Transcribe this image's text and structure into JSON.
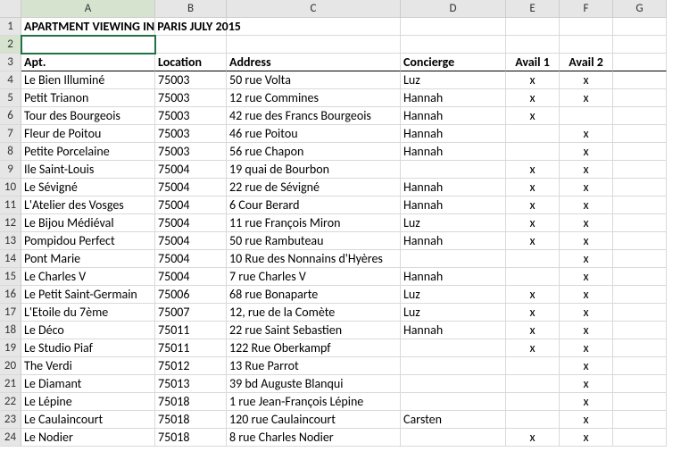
{
  "columns": [
    "A",
    "B",
    "C",
    "D",
    "E",
    "F",
    "G"
  ],
  "title": "APARTMENT VIEWING IN PARIS JULY 2015",
  "headers": {
    "apt": "Apt.",
    "location": "Location",
    "address": "Address",
    "concierge": "Concierge",
    "avail1": "Avail 1",
    "avail2": "Avail 2"
  },
  "active": {
    "col": 0,
    "row": 2
  },
  "rows": [
    {
      "n": 4,
      "apt": " Le Bien Illuminé",
      "loc": "75003",
      "addr": "50 rue Volta",
      "con": "Luz",
      "a1": "x",
      "a2": "x"
    },
    {
      "n": 5,
      "apt": " Petit Trianon",
      "loc": "75003",
      "addr": "12 rue Commines",
      "con": "Hannah",
      "a1": "x",
      "a2": "x"
    },
    {
      "n": 6,
      "apt": " Tour des Bourgeois",
      "loc": "75003",
      "addr": "42 rue des Francs Bourgeois",
      "con": "Hannah",
      "a1": "x",
      "a2": ""
    },
    {
      "n": 7,
      "apt": " Fleur de Poitou",
      "loc": "75003",
      "addr": "46 rue Poitou",
      "con": "Hannah",
      "a1": "",
      "a2": "x"
    },
    {
      "n": 8,
      "apt": " Petite Porcelaine",
      "loc": "75003",
      "addr": "56 rue Chapon",
      "con": "Hannah",
      "a1": "",
      "a2": "x"
    },
    {
      "n": 9,
      "apt": " Ile Saint-Louis",
      "loc": "75004",
      "addr": "19 quai de Bourbon",
      "con": "",
      "a1": "x",
      "a2": "x"
    },
    {
      "n": 10,
      "apt": " Le Sévigné",
      "loc": "75004",
      "addr": "22 rue de Sévigné",
      "con": "Hannah",
      "a1": "x",
      "a2": "x"
    },
    {
      "n": 11,
      "apt": " L'Atelier des Vosges",
      "loc": "75004",
      "addr": "6 Cour Berard",
      "con": "Hannah",
      "a1": "x",
      "a2": "x"
    },
    {
      "n": 12,
      "apt": " Le Bijou Médiéval",
      "loc": "75004",
      "addr": "11 rue François Miron",
      "con": "Luz",
      "a1": "x",
      "a2": "x"
    },
    {
      "n": 13,
      "apt": " Pompidou Perfect",
      "loc": "75004",
      "addr": "50 rue Rambuteau",
      "con": "Hannah",
      "a1": "x",
      "a2": "x"
    },
    {
      "n": 14,
      "apt": " Pont Marie",
      "loc": "75004",
      "addr": "10 Rue des Nonnains d'Hyères",
      "con": "",
      "a1": "",
      "a2": "x"
    },
    {
      "n": 15,
      "apt": " Le Charles V",
      "loc": "75004",
      "addr": "7 rue Charles V",
      "con": "Hannah",
      "a1": "",
      "a2": "x"
    },
    {
      "n": 16,
      "apt": " Le Petit Saint-Germain",
      "loc": "75006",
      "addr": "68 rue Bonaparte",
      "con": "Luz",
      "a1": "x",
      "a2": "x"
    },
    {
      "n": 17,
      "apt": " L'Etoile du 7ème",
      "loc": "75007",
      "addr": "12, rue de la Comète",
      "con": "Luz",
      "a1": "x",
      "a2": "x"
    },
    {
      "n": 18,
      "apt": " Le Déco",
      "loc": "75011",
      "addr": "22 rue Saint Sebastien",
      "con": "Hannah",
      "a1": "x",
      "a2": "x"
    },
    {
      "n": 19,
      "apt": " Le Studio Piaf",
      "loc": "75011",
      "addr": "122 Rue Oberkampf",
      "con": "",
      "a1": "x",
      "a2": "x"
    },
    {
      "n": 20,
      "apt": " The Verdi",
      "loc": "75012",
      "addr": "13 Rue Parrot",
      "con": "",
      "a1": "",
      "a2": "x"
    },
    {
      "n": 21,
      "apt": " Le Diamant",
      "loc": "75013",
      "addr": "39 bd Auguste Blanqui",
      "con": "",
      "a1": "",
      "a2": "x"
    },
    {
      "n": 22,
      "apt": "  Le Lépine",
      "loc": "75018",
      "addr": "1 rue Jean-François Lépine",
      "con": "",
      "a1": "",
      "a2": "x"
    },
    {
      "n": 23,
      "apt": " Le Caulaincourt",
      "loc": "75018",
      "addr": "120 rue Caulaincourt",
      "con": "Carsten",
      "a1": "",
      "a2": "x"
    },
    {
      "n": 24,
      "apt": " Le Nodier",
      "loc": "75018",
      "addr": "8 rue Charles Nodier",
      "con": "",
      "a1": "x",
      "a2": "x"
    }
  ]
}
